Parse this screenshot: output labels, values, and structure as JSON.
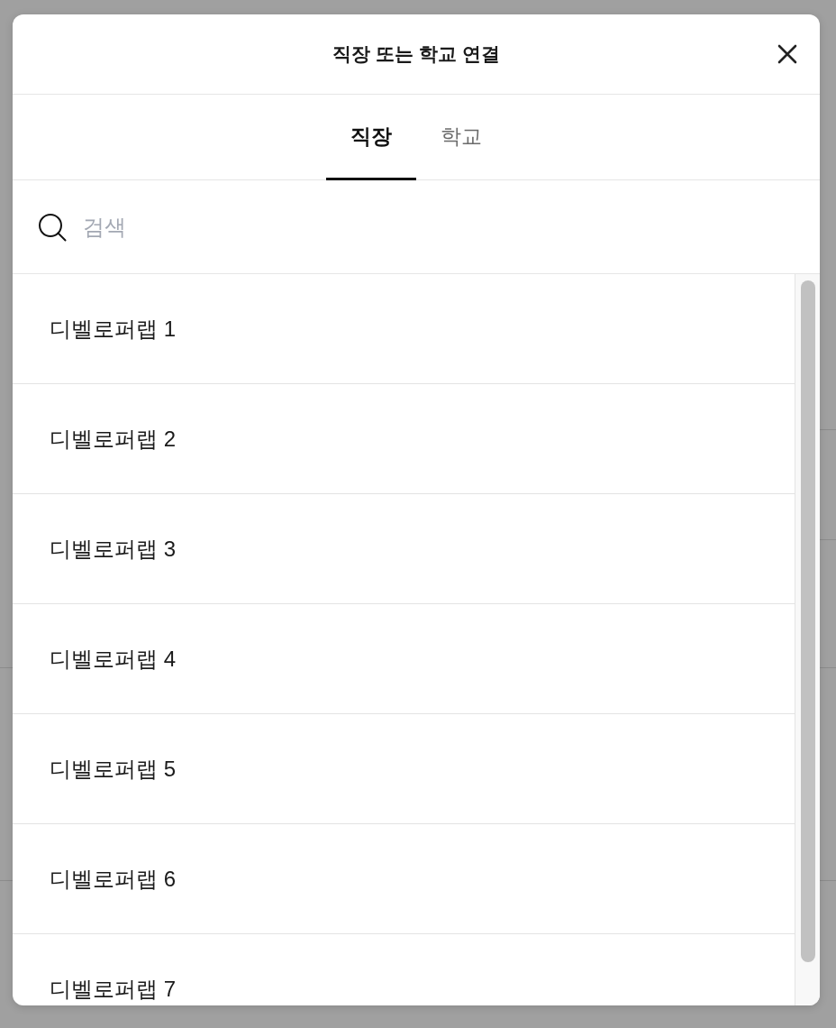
{
  "dialog": {
    "title": "직장 또는 학교 연결"
  },
  "tabs": [
    {
      "label": "직장",
      "selected": true
    },
    {
      "label": "학교",
      "selected": false
    }
  ],
  "search": {
    "placeholder": "검색"
  },
  "results": [
    {
      "label": "디벨로퍼랩 1"
    },
    {
      "label": "디벨로퍼랩 2"
    },
    {
      "label": "디벨로퍼랩 3"
    },
    {
      "label": "디벨로퍼랩 4"
    },
    {
      "label": "디벨로퍼랩 5"
    },
    {
      "label": "디벨로퍼랩 6"
    },
    {
      "label": "디벨로퍼랩 7"
    }
  ]
}
